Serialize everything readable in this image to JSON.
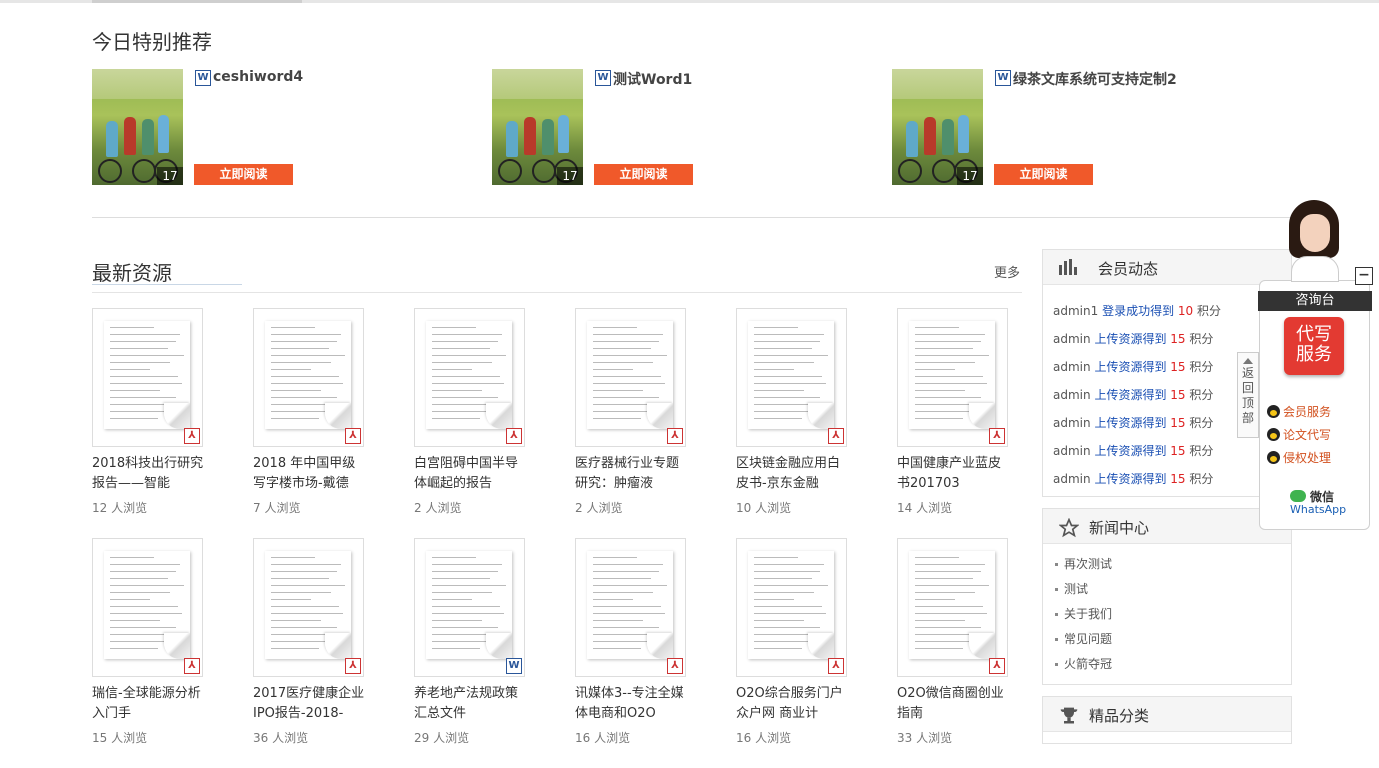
{
  "recommend": {
    "title": "今日特别推荐",
    "items": [
      {
        "name": "ceshiword4",
        "views": "17",
        "type_icon": "W",
        "button": "立即阅读"
      },
      {
        "name": "测试Word1",
        "views": "17",
        "type_icon": "W",
        "button": "立即阅读"
      },
      {
        "name": "绿茶文库系统可支持定制2",
        "views": "17",
        "type_icon": "W",
        "button": "立即阅读"
      }
    ]
  },
  "latest": {
    "title": "最新资源",
    "more": "更多",
    "docs": [
      {
        "title": "2018科技出行研究报告——智能",
        "views": "12  人浏览",
        "type": "pdf"
      },
      {
        "title": "2018 年中国甲级写字楼市场-戴德",
        "views": "7  人浏览",
        "type": "pdf"
      },
      {
        "title": "白宫阻碍中国半导体崛起的报告",
        "views": "2  人浏览",
        "type": "pdf"
      },
      {
        "title": "医疗器械行业专题研究：肿瘤液",
        "views": "2  人浏览",
        "type": "pdf"
      },
      {
        "title": "区块链金融应用白皮书-京东金融",
        "views": "10  人浏览",
        "type": "pdf"
      },
      {
        "title": "中国健康产业蓝皮书201703",
        "views": "14  人浏览",
        "type": "pdf"
      },
      {
        "title": "瑞信-全球能源分析入门手",
        "views": "15  人浏览",
        "type": "pdf"
      },
      {
        "title": "2017医疗健康企业IPO报告-2018-",
        "views": "36  人浏览",
        "type": "pdf"
      },
      {
        "title": "养老地产法规政策汇总文件",
        "views": "29  人浏览",
        "type": "word"
      },
      {
        "title": "讯媒体3--专注全媒体电商和O2O",
        "views": "16  人浏览",
        "type": "pdf"
      },
      {
        "title": "O2O综合服务门户众户网 商业计",
        "views": "16  人浏览",
        "type": "pdf"
      },
      {
        "title": "O2O微信商圈创业指南",
        "views": "33  人浏览",
        "type": "pdf"
      }
    ]
  },
  "member_activity": {
    "title": "会员动态",
    "items": [
      {
        "user": "admin1",
        "action": "登录成功得到",
        "points": "10",
        "unit": "积分"
      },
      {
        "user": "admin",
        "action": "上传资源得到",
        "points": "15",
        "unit": "积分"
      },
      {
        "user": "admin",
        "action": "上传资源得到",
        "points": "15",
        "unit": "积分"
      },
      {
        "user": "admin",
        "action": "上传资源得到",
        "points": "15",
        "unit": "积分"
      },
      {
        "user": "admin",
        "action": "上传资源得到",
        "points": "15",
        "unit": "积分"
      },
      {
        "user": "admin",
        "action": "上传资源得到",
        "points": "15",
        "unit": "积分"
      },
      {
        "user": "admin",
        "action": "上传资源得到",
        "points": "15",
        "unit": "积分"
      }
    ]
  },
  "news_center": {
    "title": "新闻中心",
    "items": [
      "再次测试",
      "测试",
      "关于我们",
      "常见问题",
      "火箭夺冠"
    ]
  },
  "categories": {
    "title": "精品分类"
  },
  "consult": {
    "bar": "咨询台",
    "ghost_button": "代写服务",
    "ghost_line1": "代写",
    "ghost_line2": "服务",
    "links": [
      "会员服务",
      "论文代写",
      "侵权处理"
    ],
    "wechat": "微信",
    "whatsapp": "WhatsApp",
    "back_top": "返回顶部",
    "minimize": "−"
  },
  "colors": {
    "accent": "#f0592a",
    "link_blue": "#1a4fb3",
    "points_red": "#d22222",
    "ghost_red": "#e33a32"
  }
}
